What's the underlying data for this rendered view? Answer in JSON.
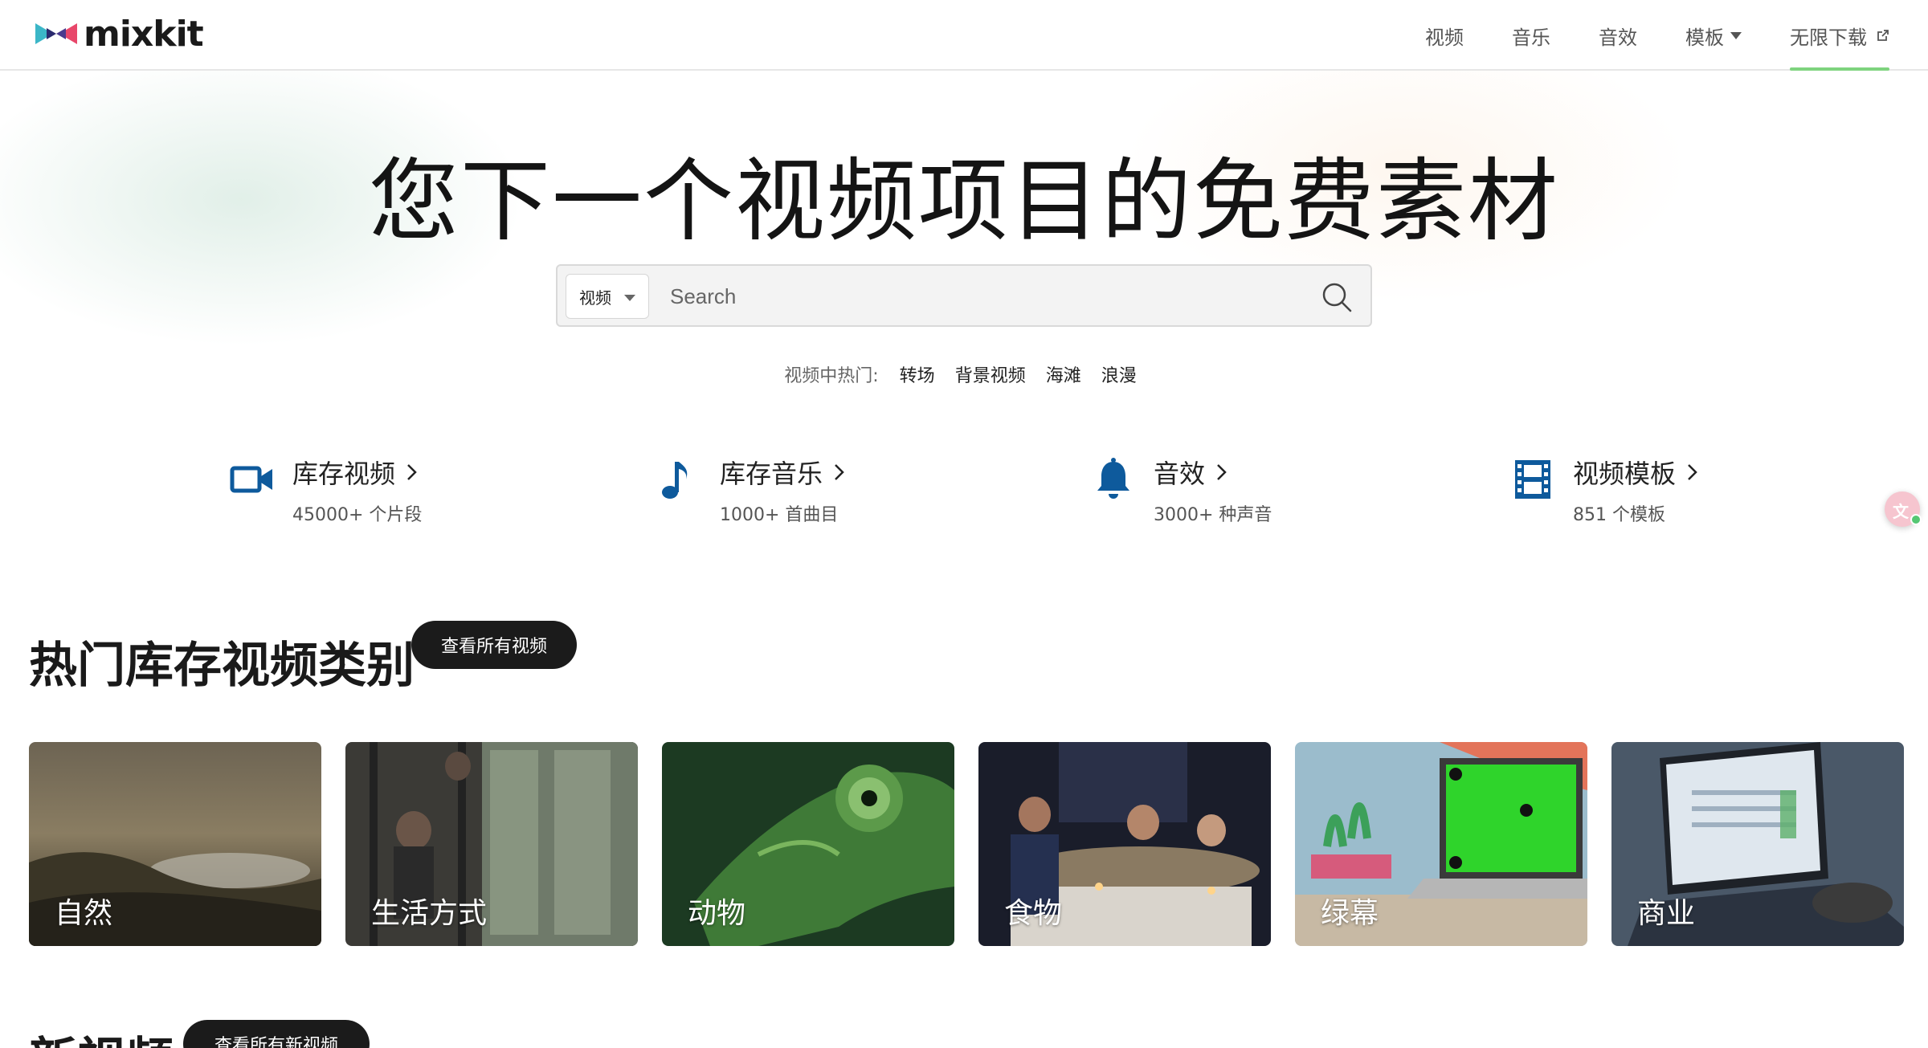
{
  "header": {
    "logo_text": "mixkit",
    "nav": [
      {
        "label": "视频"
      },
      {
        "label": "音乐"
      },
      {
        "label": "音效"
      },
      {
        "label": "模板"
      },
      {
        "label": "无限下载"
      }
    ]
  },
  "hero": {
    "title": "您下一个视频项目的免费素材",
    "search": {
      "type_selected": "视频",
      "placeholder": "Search"
    },
    "trending": {
      "label": "视频中热门:",
      "tags": [
        "转场",
        "背景视频",
        "海滩",
        "浪漫"
      ]
    }
  },
  "categories": [
    {
      "title": "库存视频",
      "sub": "45000+ 个片段",
      "icon": "video-camera-icon"
    },
    {
      "title": "库存音乐",
      "sub": "1000+ 首曲目",
      "icon": "music-note-icon"
    },
    {
      "title": "音效",
      "sub": "3000+ 种声音",
      "icon": "bell-icon"
    },
    {
      "title": "视频模板",
      "sub": "851 个模板",
      "icon": "film-strip-icon"
    }
  ],
  "popular": {
    "title": "热门库存视频类别",
    "view_all": "查看所有视频",
    "tiles": [
      {
        "label": "自然"
      },
      {
        "label": "生活方式"
      },
      {
        "label": "动物"
      },
      {
        "label": "食物"
      },
      {
        "label": "绿幕"
      },
      {
        "label": "商业"
      }
    ]
  },
  "new_videos": {
    "title": "新视频",
    "view_all": "查看所有新视频"
  },
  "colors": {
    "accent_green": "#7ed37e",
    "icon_blue": "#0e5a9c",
    "dark_button": "#1b1b1b"
  }
}
